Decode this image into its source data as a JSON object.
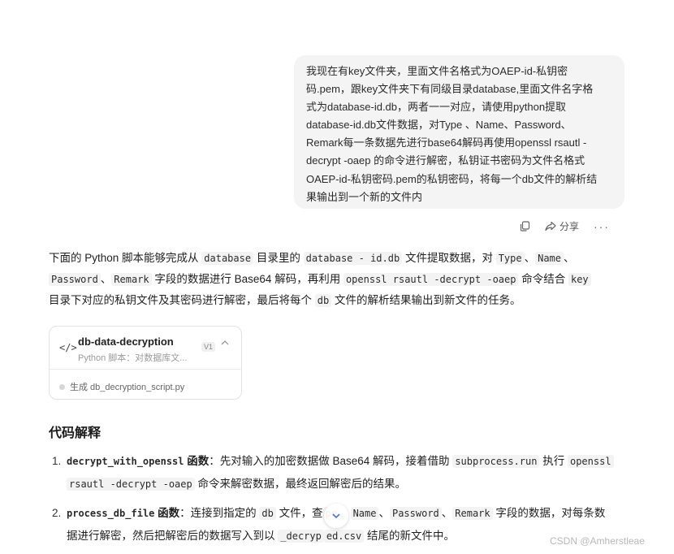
{
  "user_message": {
    "lines": [
      "我现在有key文件夹，里面文件名格式为OAEP-id-私钥密",
      "码.pem，跟key文件夹下有同级目录database,里面文件名字格",
      "式为database-id.db，两者一一对应，请使用python提取",
      "database-id.db文件数据，对Type 、Name、Password、",
      "Remark每一条数据先进行base64解码再使用openssl rsautl -",
      "decrypt -oaep 的命令进行解密，私钥证书密码为文件名格式",
      "OAEP-id-私钥密码.pem的私钥密码，将每一个db文件的解析结",
      "果输出到一个新的文件内"
    ]
  },
  "message_actions": {
    "copy_icon": "copy-icon",
    "share_label": "分享",
    "more_label": "···"
  },
  "answer": {
    "line1": {
      "a": "下面的 Python 脚本能够完成从 ",
      "c1": "database",
      "b": " 目录里的 ",
      "c2": "database - id.db",
      "d": " 文件提取数据，对 ",
      "c3": "Type",
      "e": "、",
      "c4": "Name",
      "f": "、"
    },
    "line2": {
      "c1": "Password",
      "a": "、",
      "c2": "Remark",
      "b": " 字段的数据进行 Base64 解码，再利用 ",
      "c3": "openssl rsautl -decrypt -oaep",
      "c": " 命令结合 ",
      "c4": "key"
    },
    "line3": {
      "a": "目录下对应的私钥文件及其密码进行解密，最后将每个 ",
      "c1": "db",
      "b": " 文件的解析结果输出到新文件的任务。"
    }
  },
  "artifact_card": {
    "icon": "</>",
    "title": "db-data-decryption",
    "subtitle": "Python 脚本：对数据库文...",
    "version": "V1",
    "status": "生成 db_decryption_script.py"
  },
  "section_title": "代码解释",
  "explanations": [
    {
      "num": "1.",
      "fn": "decrypt_with_openssl",
      "fn_suffix": " 函数",
      "l1_a": "：先对输入的加密数据做 Base64 解码，接着借助 ",
      "l1_c1": "subprocess.run",
      "l1_b": " 执行 ",
      "l1_c2": "openssl",
      "l2_c1": "rsautl -decrypt -oaep",
      "l2_a": " 命令来解密数据，最终返回解密后的结果。"
    },
    {
      "num": "2.",
      "fn": "process_db_file",
      "fn_suffix": " 函数",
      "l1_a": "：连接到指定的 ",
      "l1_c1": "db",
      "l1_b": " 文件，查",
      "l1_c2": "pe",
      "l1_c": "、",
      "l1_c3": "Name",
      "l1_d": "、",
      "l1_c4": "Password",
      "l1_e": "、",
      "l1_c5": "Remark",
      "l1_f": " 字段的数据，对每条数",
      "l2_a": "据进行解密，然后把解密后的数据写入到以 ",
      "l2_c1": "_decryp",
      "l2_c2": "ed.csv",
      "l2_b": " 结尾的新文件中。"
    }
  ],
  "scroll_down_icon": "chevron-down-icon",
  "watermark": "CSDN @Amherstleae"
}
